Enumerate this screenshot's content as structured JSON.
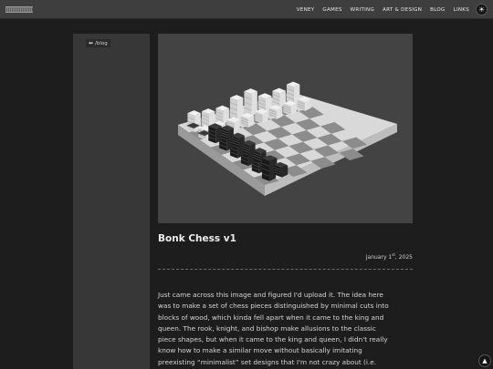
{
  "header": {
    "nav": [
      {
        "label": "VENEY"
      },
      {
        "label": "GAMES"
      },
      {
        "label": "WRITING"
      },
      {
        "label": "ART & DESIGN"
      },
      {
        "label": "BLOG"
      },
      {
        "label": "LINKS"
      }
    ],
    "theme_icon": "sun-icon"
  },
  "sidebar": {
    "back_arrow": "⬅",
    "back_label": "/blog"
  },
  "post": {
    "hero_image": "chess-board-image",
    "title": "Bonk Chess v1",
    "date_prefix": "January 1",
    "date_suffix": "st",
    "date_year": ", 2025",
    "paragraph_lines": [
      "Just came across this image and figured I'd upload it. The idea here",
      "was to make a set of chess pieces distinguished by minimal cuts into",
      "blocks of wood, which kinda fell apart when it came to the king and",
      "queen. The rook, knight, and bishop make allusions to the classic",
      "piece shapes, but when it came to the king and queen, I didn't really",
      "know how to make a similar move without basically imitating",
      "preexisting “minimalist” set designs that I'm not crazy about (i.e."
    ]
  },
  "scroll_icon": "arrow-up-icon"
}
